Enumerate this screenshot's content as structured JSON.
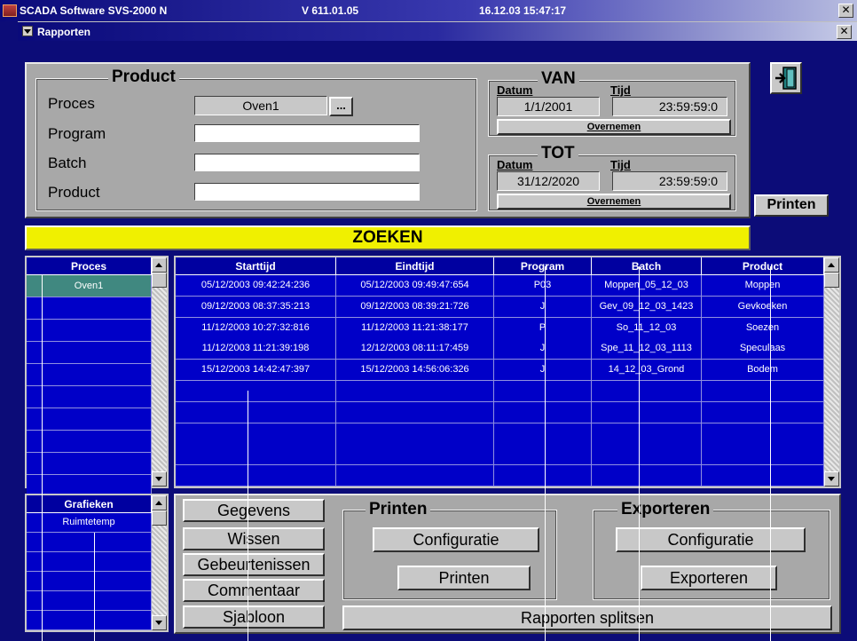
{
  "titlebar": {
    "app": "SCADA Software  SVS-2000 N",
    "version": "V 611.01.05",
    "datetime": "16.12.03  15:47:17",
    "close": "✕"
  },
  "window": {
    "title": "Rapporten",
    "close": "✕"
  },
  "product_group": {
    "legend": "Product",
    "proces_label": "Proces",
    "proces_value": "Oven1",
    "browse_label": "...",
    "program_label": "Program",
    "program_value": "",
    "batch_label": "Batch",
    "batch_value": "",
    "product_label": "Product",
    "product_value": ""
  },
  "van": {
    "legend": "VAN",
    "datum_label": "Datum",
    "tijd_label": "Tijd",
    "datum": "1/1/2001",
    "tijd": "23:59:59:0",
    "button": "Overnemen"
  },
  "tot": {
    "legend": "TOT",
    "datum_label": "Datum",
    "tijd_label": "Tijd",
    "datum": "31/12/2020",
    "tijd": "23:59:59:0",
    "button": "Overnemen"
  },
  "printen_top": "Printen",
  "zoeken": "ZOEKEN",
  "proces_list": {
    "header": "Proces",
    "items": [
      "Oven1",
      "",
      "",
      "",
      "",
      "",
      "",
      "",
      "",
      ""
    ]
  },
  "results": {
    "headers": [
      "Starttijd",
      "Eindtijd",
      "Program",
      "Batch",
      "Product"
    ],
    "rows": [
      [
        "05/12/2003 09:42:24:236",
        "05/12/2003 09:49:47:654",
        "P03",
        "Moppen_05_12_03",
        "Moppen"
      ],
      [
        "09/12/2003 08:37:35:213",
        "09/12/2003 08:39:21:726",
        "J",
        "Gev_09_12_03_1423",
        "Gevkoeken"
      ],
      [
        "11/12/2003 10:27:32:816",
        "11/12/2003 11:21:38:177",
        "P",
        "So_11_12_03",
        "Soezen"
      ],
      [
        "11/12/2003 11:21:39:198",
        "12/12/2003 08:11:17:459",
        "J",
        "Spe_11_12_03_1113",
        "Speculaas"
      ],
      [
        "15/12/2003 14:42:47:397",
        "15/12/2003 14:56:06:326",
        "J",
        "14_12_03_Grond",
        "Bodem"
      ],
      [
        "",
        "",
        "",
        "",
        ""
      ],
      [
        "",
        "",
        "",
        "",
        ""
      ],
      [
        "",
        "",
        "",
        "",
        ""
      ],
      [
        "",
        "",
        "",
        "",
        ""
      ],
      [
        "",
        "",
        "",
        "",
        ""
      ]
    ]
  },
  "grafieken": {
    "header": "Grafieken",
    "items": [
      "Ruimtetemp",
      "",
      "",
      "",
      "",
      ""
    ]
  },
  "actions": {
    "gegevens": "Gegevens",
    "wissen": "Wissen",
    "gebeurtenissen": "Gebeurtenissen",
    "commentaar": "Commentaar",
    "sjabloon": "Sjabloon",
    "printen_legend": "Printen",
    "printen_config": "Configuratie",
    "printen_btn": "Printen",
    "exporteren_legend": "Exporteren",
    "exporteren_config": "Configuratie",
    "exporteren_btn": "Exporteren",
    "splitsen": "Rapporten splitsen"
  }
}
